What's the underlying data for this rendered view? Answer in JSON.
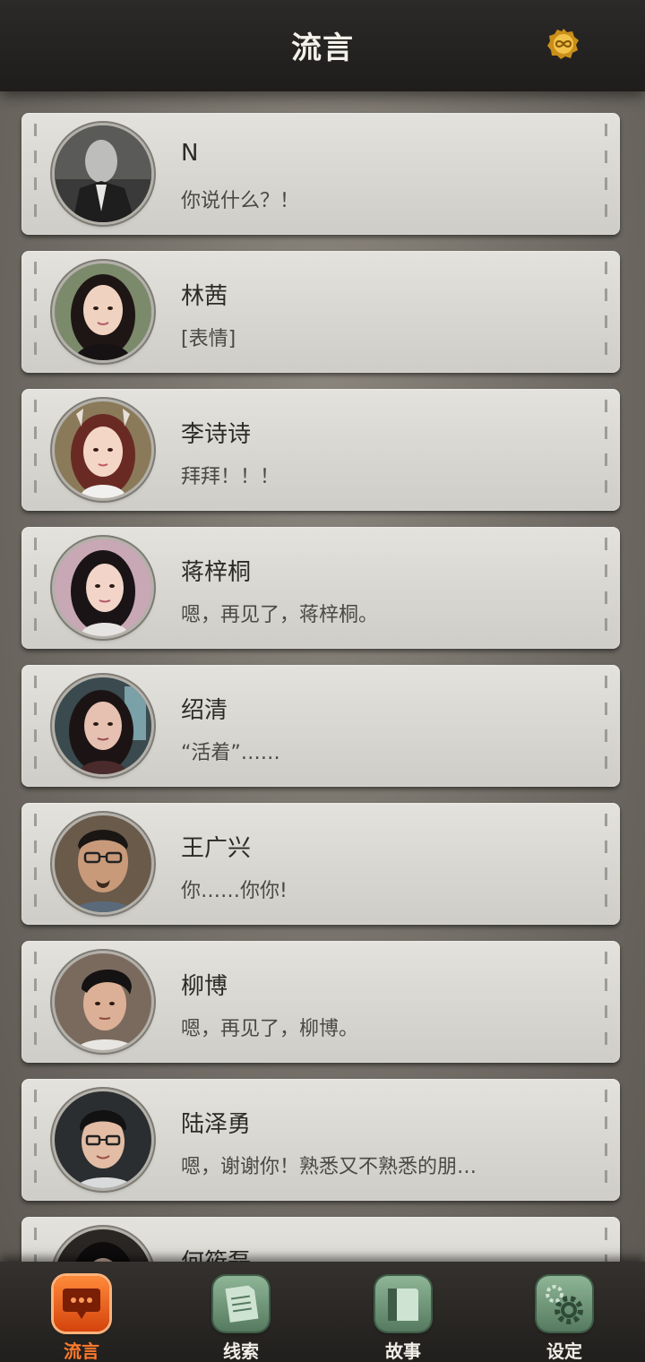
{
  "header": {
    "title": "流言",
    "coin_icon": "infinity-coin-icon"
  },
  "conversations": [
    {
      "name": "N",
      "message": "你说什么？！"
    },
    {
      "name": "林茜",
      "message": "[表情]"
    },
    {
      "name": "李诗诗",
      "message": "拜拜！！！"
    },
    {
      "name": "蒋梓桐",
      "message": "嗯，再见了，蒋梓桐。"
    },
    {
      "name": "绍清",
      "message": "“活着”……"
    },
    {
      "name": "王广兴",
      "message": "你……你你!"
    },
    {
      "name": "柳博",
      "message": "嗯，再见了，柳博。"
    },
    {
      "name": "陆泽勇",
      "message": "嗯，谢谢你！熟悉又不熟悉的朋…"
    },
    {
      "name": "何筱磊",
      "message": ""
    }
  ],
  "tabs": [
    {
      "label": "流言",
      "icon": "chat-bubble-icon",
      "active": true
    },
    {
      "label": "线索",
      "icon": "notes-icon",
      "active": false
    },
    {
      "label": "故事",
      "icon": "book-icon",
      "active": false
    },
    {
      "label": "设定",
      "icon": "gear-icon",
      "active": false
    }
  ],
  "colors": {
    "active_tab": "#ff7a2c",
    "idle_tab": "#6f9a79",
    "header_bg": "#252321"
  }
}
